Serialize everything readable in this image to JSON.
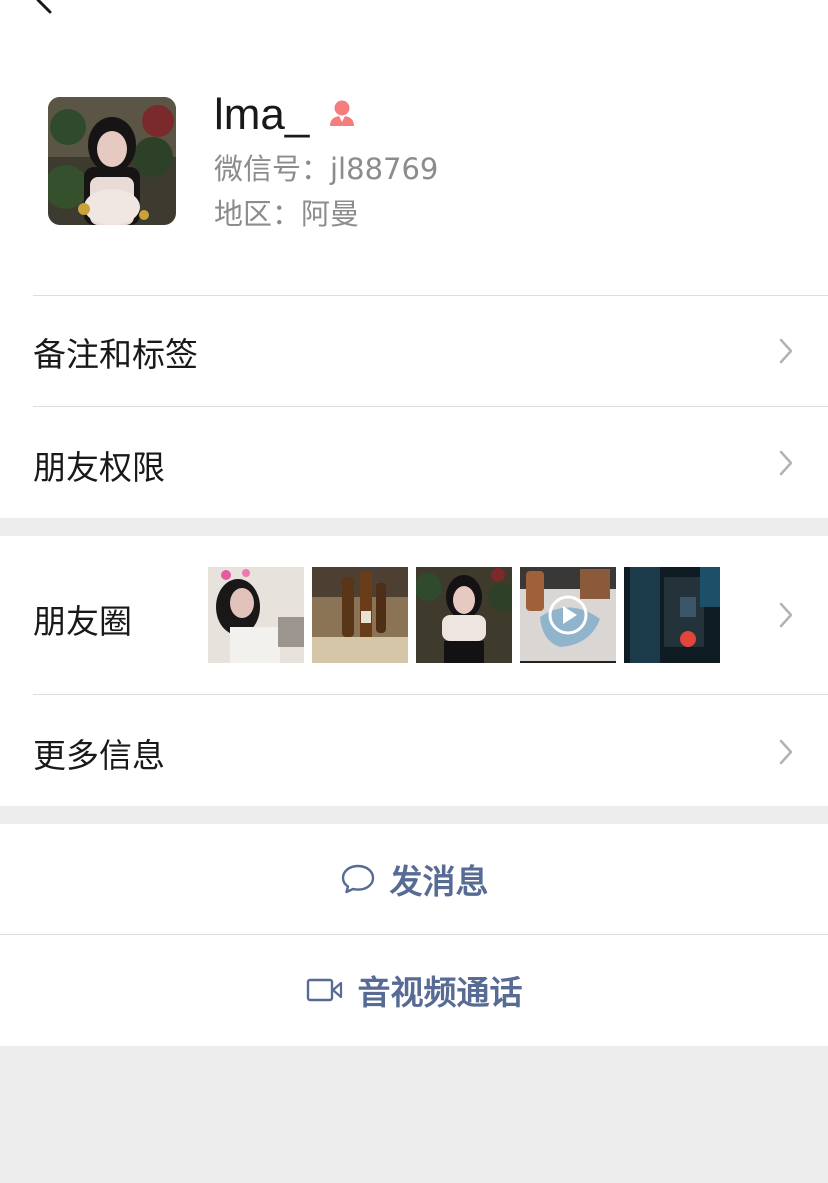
{
  "profile": {
    "name": "lma_",
    "wechat_id": "微信号：jl88769",
    "region": "地区：阿曼",
    "gender_icon": "female-icon",
    "gender_color": "#f37e7d"
  },
  "rows": {
    "remarks": "备注和标签",
    "permissions": "朋友权限",
    "moments": "朋友圈",
    "more_info": "更多信息"
  },
  "actions": {
    "message": "发消息",
    "call": "音视频通话"
  },
  "colors": {
    "link": "#576b95",
    "background": "#ededed",
    "separator": "#dedede"
  }
}
